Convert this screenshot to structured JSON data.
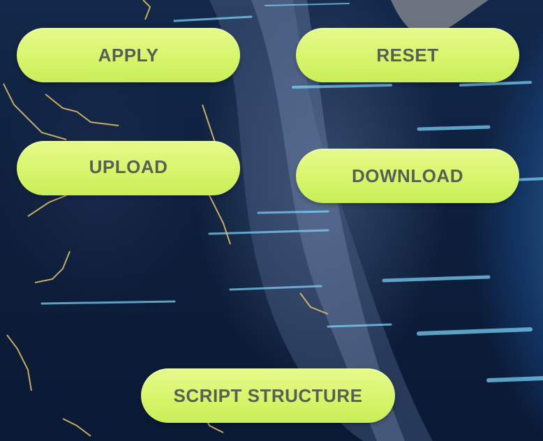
{
  "buttons": {
    "apply": "APPLY",
    "reset": "RESET",
    "upload": "UPLOAD",
    "download": "DOWNLOAD",
    "script_structure": "SCRIPT STRUCTURE"
  },
  "colors": {
    "button_fill": "#d7f56c",
    "button_text": "#5a5f55",
    "background": "#0d1f3c",
    "accent_glow": "#78c8ff",
    "gold_veins": "#e8c36a"
  }
}
